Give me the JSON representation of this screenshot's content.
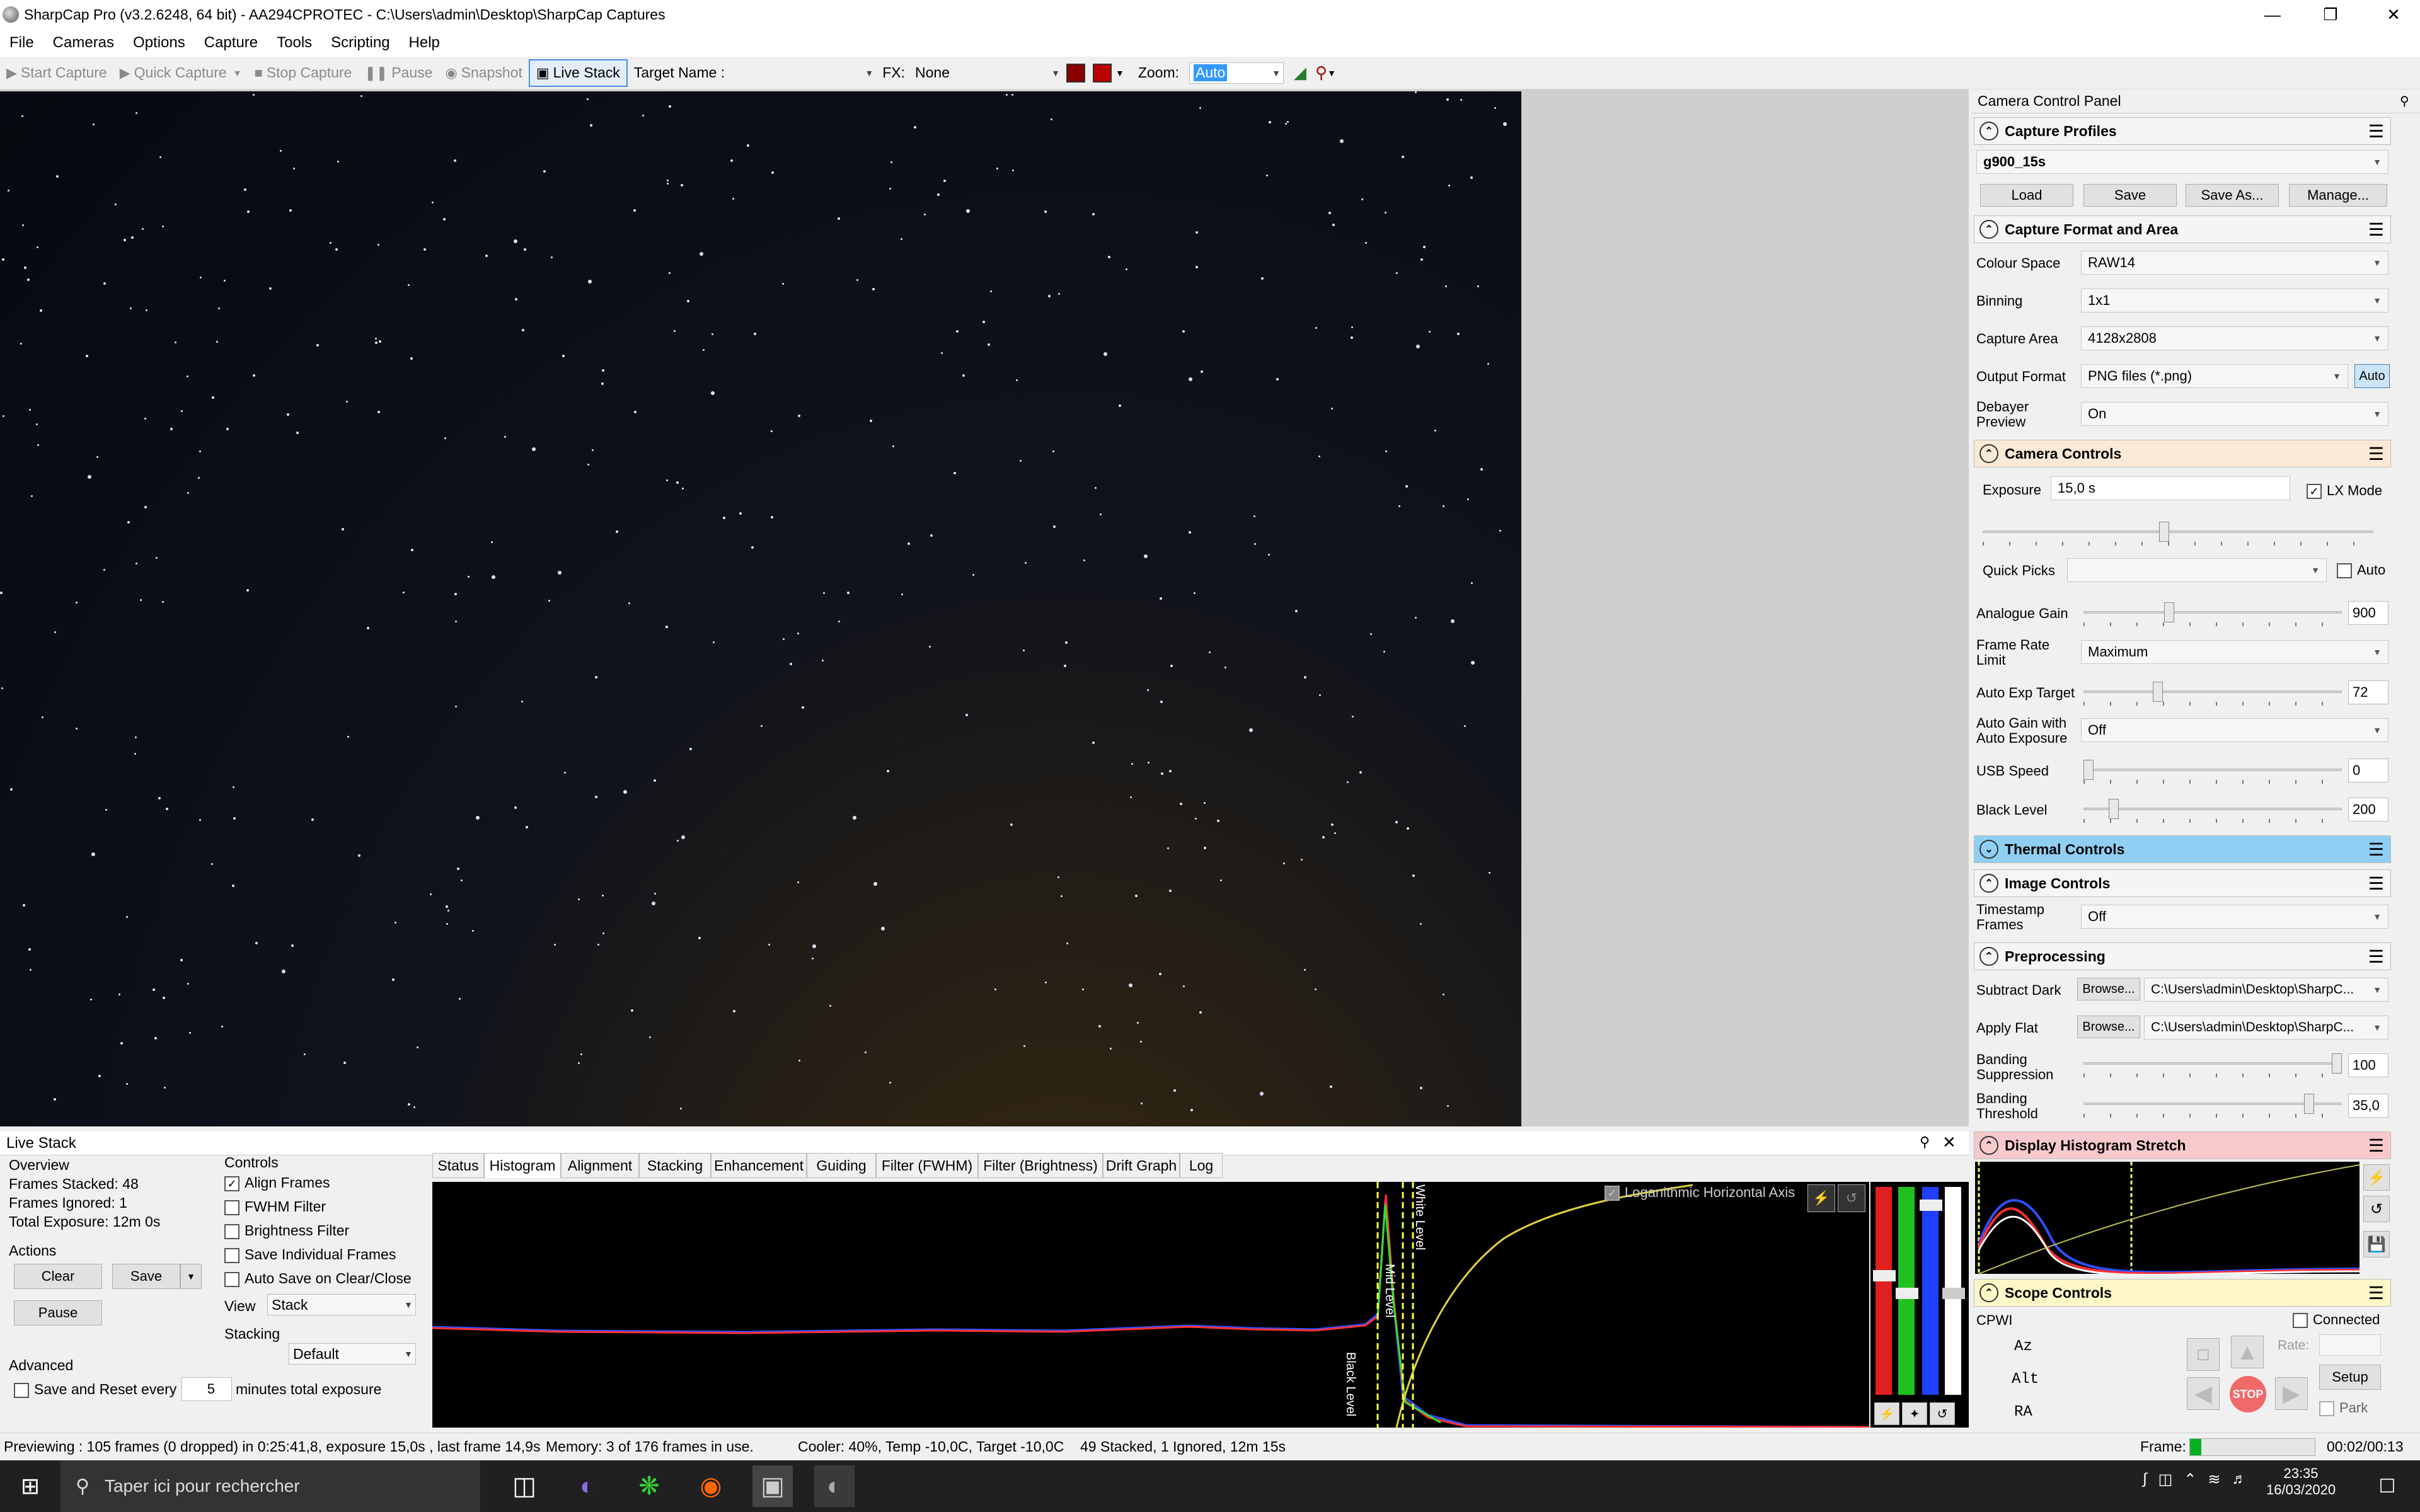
{
  "window": {
    "title": "SharpCap Pro (v3.2.6248, 64 bit) - AA294CPROTEC - C:\\Users\\admin\\Desktop\\SharpCap Captures"
  },
  "menu": [
    "File",
    "Cameras",
    "Options",
    "Capture",
    "Tools",
    "Scripting",
    "Help"
  ],
  "toolbar": {
    "start_capture": "Start Capture",
    "quick_capture": "Quick Capture",
    "stop_capture": "Stop Capture",
    "pause": "Pause",
    "snapshot": "Snapshot",
    "live_stack": "Live Stack",
    "target_name_label": "Target Name :",
    "fx_label": "FX:",
    "fx_value": "None",
    "zoom_label": "Zoom:",
    "zoom_value": "Auto"
  },
  "panel": {
    "title": "Camera Control Panel",
    "capture_profiles": {
      "title": "Capture Profiles",
      "value": "g900_15s",
      "buttons": [
        "Load",
        "Save",
        "Save As...",
        "Manage..."
      ]
    },
    "capture_format": {
      "title": "Capture Format and Area",
      "colour_space_label": "Colour Space",
      "colour_space": "RAW14",
      "binning_label": "Binning",
      "binning": "1x1",
      "capture_area_label": "Capture Area",
      "capture_area": "4128x2808",
      "output_format_label": "Output Format",
      "output_format": "PNG files (*.png)",
      "auto": "Auto",
      "debayer_label": "Debayer Preview",
      "debayer": "On"
    },
    "camera_controls": {
      "title": "Camera Controls",
      "exposure_label": "Exposure",
      "exposure": "15,0 s",
      "lx_mode": "LX Mode",
      "quick_picks_label": "Quick Picks",
      "auto": "Auto",
      "analogue_gain_label": "Analogue Gain",
      "analogue_gain": "900",
      "frame_rate_label": "Frame Rate Limit",
      "frame_rate": "Maximum",
      "auto_exp_label": "Auto Exp Target",
      "auto_exp": "72",
      "auto_gain_label": "Auto Gain with Auto Exposure",
      "auto_gain": "Off",
      "usb_speed_label": "USB Speed",
      "usb_speed": "0",
      "black_level_label": "Black Level",
      "black_level": "200"
    },
    "thermal_controls": {
      "title": "Thermal Controls"
    },
    "image_controls": {
      "title": "Image Controls",
      "timestamp_label": "Timestamp Frames",
      "timestamp": "Off"
    },
    "preprocessing": {
      "title": "Preprocessing",
      "subtract_dark_label": "Subtract Dark",
      "apply_flat_label": "Apply Flat",
      "browse": "Browse...",
      "path": "C:\\Users\\admin\\Desktop\\SharpC...",
      "banding_suppression_label": "Banding Suppression",
      "banding_suppression": "100",
      "banding_threshold_label": "Banding Threshold",
      "banding_threshold": "35,0"
    },
    "histogram_stretch": {
      "title": "Display Histogram Stretch"
    },
    "scope_controls": {
      "title": "Scope Controls",
      "mount": "CPWI",
      "connected": "Connected",
      "axes": [
        "Az",
        "Alt",
        "RA"
      ],
      "rate_label": "Rate:",
      "setup": "Setup",
      "park": "Park",
      "stop": "STOP"
    }
  },
  "livestack": {
    "title": "Live Stack",
    "overview_label": "Overview",
    "frames_stacked": "Frames Stacked: 48",
    "frames_ignored": "Frames Ignored:  1",
    "total_exposure": "Total Exposure:  12m 0s",
    "actions_label": "Actions",
    "clear": "Clear",
    "save": "Save",
    "pause": "Pause",
    "advanced_label": "Advanced",
    "save_reset": "Save and Reset every",
    "save_reset_value": "5",
    "minutes_label": "minutes total exposure",
    "controls_label": "Controls",
    "checkboxes": [
      "Align Frames",
      "FWHM Filter",
      "Brightness Filter",
      "Save Individual Frames",
      "Auto Save on Clear/Close"
    ],
    "view_label": "View",
    "view": "Stack",
    "stacking_label": "Stacking",
    "stacking": "Default",
    "tabs": [
      "Status",
      "Histogram",
      "Alignment",
      "Stacking",
      "Enhancement",
      "Guiding",
      "Filter (FWHM)",
      "Filter (Brightness)",
      "Drift Graph",
      "Log"
    ],
    "histogram": {
      "log_axis": "Loganithmic Horizontal Axis",
      "black_level": "Black Level",
      "mid_level": "Mid Level",
      "white_level": "White Level"
    }
  },
  "status": {
    "preview": "Previewing : 105 frames (0 dropped) in 0:25:41,8, exposure 15,0s , last frame 14,9s",
    "memory": "Memory: 3 of 176 frames in use.",
    "cooler": "Cooler: 40%, Temp -10,0C, Target -10,0C",
    "stacked": "49 Stacked, 1 Ignored, 12m 15s",
    "frame_label": "Frame:",
    "frame_time": "00:02/00:13",
    "frame_progress": 0.09
  },
  "taskbar": {
    "search": "Taper ici pour rechercher",
    "time": "23:35",
    "date": "16/03/2020"
  }
}
